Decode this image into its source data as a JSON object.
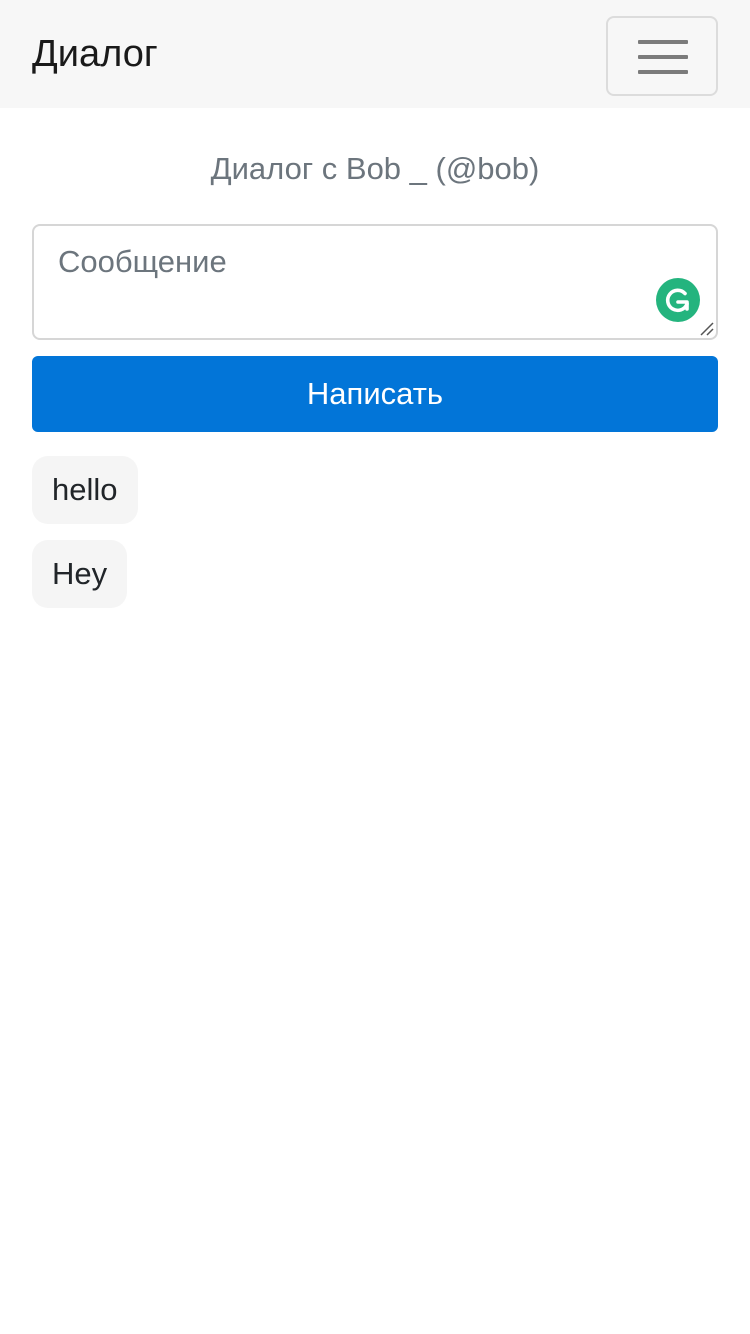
{
  "header": {
    "brand": "Диалог",
    "menu_icon": "hamburger-menu-icon"
  },
  "dialog": {
    "title": "Диалог с Bob _ (@bob)"
  },
  "composer": {
    "placeholder": "Сообщение",
    "value": "",
    "assistant_icon": "grammarly-icon",
    "send_label": "Написать"
  },
  "messages": [
    {
      "text": "hello"
    },
    {
      "text": "Hey"
    }
  ],
  "colors": {
    "navbar_bg": "#f7f7f7",
    "primary": "#0275d8",
    "bubble_bg": "#f5f5f5",
    "grammarly": "#24b47e"
  }
}
